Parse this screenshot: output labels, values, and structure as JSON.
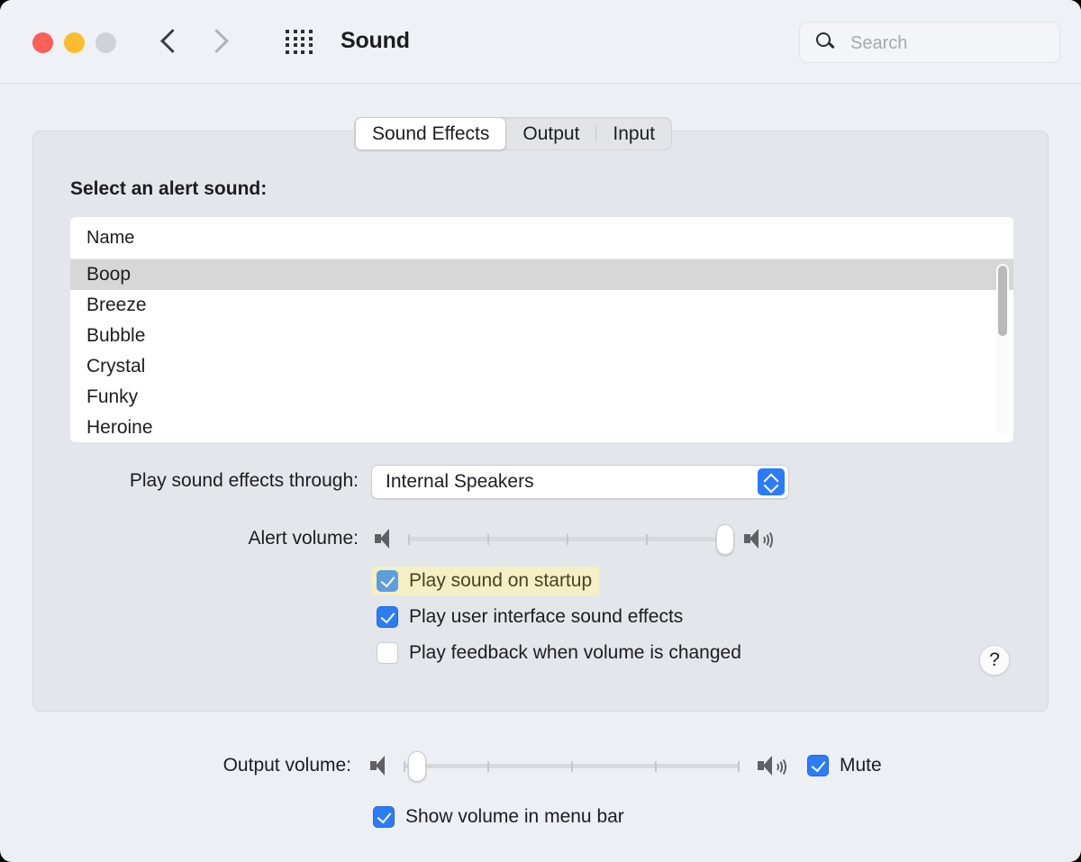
{
  "window": {
    "title": "Sound",
    "traffic_lights": [
      "close",
      "minimize",
      "zoom"
    ],
    "back_label": "Back",
    "forward_label": "Forward",
    "grid_label": "Show All"
  },
  "search": {
    "placeholder": "Search",
    "value": ""
  },
  "tabs": [
    {
      "label": "Sound Effects",
      "selected": true
    },
    {
      "label": "Output",
      "selected": false
    },
    {
      "label": "Input",
      "selected": false
    }
  ],
  "sound_effects": {
    "section_title": "Select an alert sound:",
    "list": {
      "column_header": "Name",
      "rows": [
        {
          "name": "Boop",
          "selected": true
        },
        {
          "name": "Breeze",
          "selected": false
        },
        {
          "name": "Bubble",
          "selected": false
        },
        {
          "name": "Crystal",
          "selected": false
        },
        {
          "name": "Funky",
          "selected": false
        },
        {
          "name": "Heroine",
          "selected": false
        }
      ]
    },
    "output_device": {
      "label": "Play sound effects through:",
      "value": "Internal Speakers"
    },
    "alert_volume": {
      "label": "Alert volume:",
      "value_percent": 95
    },
    "checkboxes": [
      {
        "label": "Play sound on startup",
        "checked": true,
        "highlighted": true
      },
      {
        "label": "Play user interface sound effects",
        "checked": true,
        "highlighted": false
      },
      {
        "label": "Play feedback when volume is changed",
        "checked": false,
        "highlighted": false
      }
    ],
    "help_label": "?"
  },
  "footer": {
    "output_volume": {
      "label": "Output volume:",
      "value_percent": 0
    },
    "mute": {
      "label": "Mute",
      "checked": true
    },
    "menu_bar": {
      "label": "Show volume in menu bar",
      "checked": true
    }
  },
  "colors": {
    "accent_blue": "#2b7cf7",
    "highlight_yellow": "#f4efc4",
    "window_bg": "#eceff4",
    "panel_bg": "#e3e6ea",
    "selection_gray": "#d7d7d7"
  }
}
